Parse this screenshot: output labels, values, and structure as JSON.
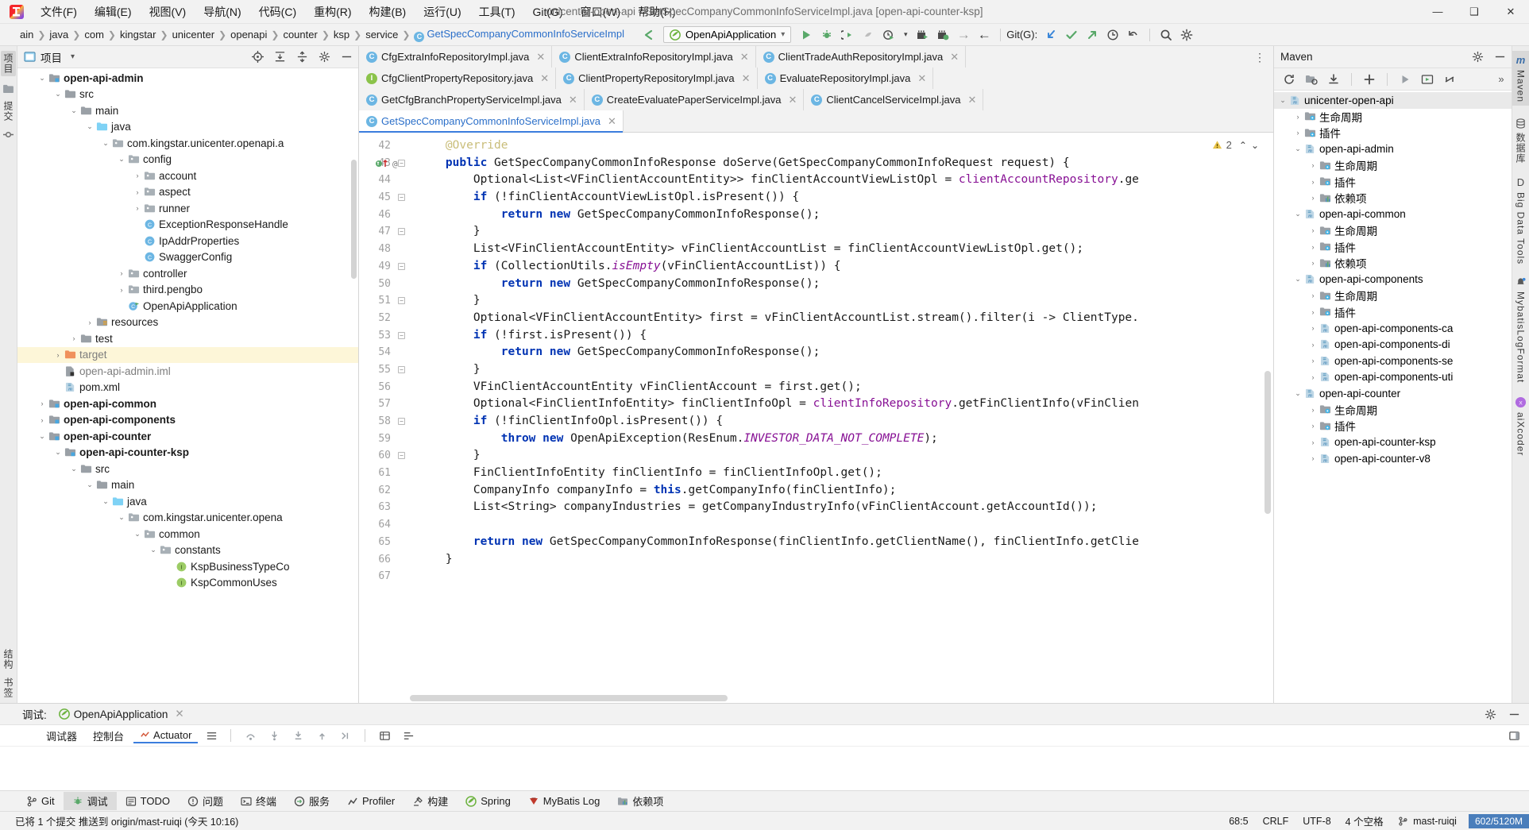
{
  "window": {
    "title": "unicenter-open-api - GetSpecCompanyCommonInfoServiceImpl.java [open-api-counter-ksp]",
    "minimize": "—",
    "maximize": "❑",
    "close": "✕"
  },
  "menu": [
    {
      "label": "文件(F)"
    },
    {
      "label": "编辑(E)"
    },
    {
      "label": "视图(V)"
    },
    {
      "label": "导航(N)"
    },
    {
      "label": "代码(C)"
    },
    {
      "label": "重构(R)"
    },
    {
      "label": "构建(B)"
    },
    {
      "label": "运行(U)"
    },
    {
      "label": "工具(T)"
    },
    {
      "label": "Git(G)"
    },
    {
      "label": "窗口(W)"
    },
    {
      "label": "帮助(H)"
    }
  ],
  "navbar": {
    "crumbs": [
      "ain",
      "java",
      "com",
      "kingstar",
      "unicenter",
      "openapi",
      "counter",
      "ksp",
      "service"
    ],
    "current_file": "GetSpecCompanyCommonInfoServiceImpl",
    "run_config": "OpenApiApplication",
    "git_label": "Git(G):"
  },
  "project_panel": {
    "title": "项目",
    "tree": [
      {
        "indent": 1,
        "twisty": "down",
        "icon": "module",
        "label": "open-api-admin",
        "bold": true
      },
      {
        "indent": 2,
        "twisty": "down",
        "icon": "folder",
        "label": "src"
      },
      {
        "indent": 3,
        "twisty": "down",
        "icon": "folder",
        "label": "main"
      },
      {
        "indent": 4,
        "twisty": "down",
        "icon": "srcfolder",
        "label": "java"
      },
      {
        "indent": 5,
        "twisty": "down",
        "icon": "package",
        "label": "com.kingstar.unicenter.openapi.a"
      },
      {
        "indent": 6,
        "twisty": "down",
        "icon": "package",
        "label": "config"
      },
      {
        "indent": 7,
        "twisty": "right",
        "icon": "package",
        "label": "account"
      },
      {
        "indent": 7,
        "twisty": "right",
        "icon": "package",
        "label": "aspect"
      },
      {
        "indent": 7,
        "twisty": "right",
        "icon": "package",
        "label": "runner"
      },
      {
        "indent": 7,
        "twisty": "none",
        "icon": "class",
        "label": "ExceptionResponseHandle"
      },
      {
        "indent": 7,
        "twisty": "none",
        "icon": "class",
        "label": "IpAddrProperties"
      },
      {
        "indent": 7,
        "twisty": "none",
        "icon": "class",
        "label": "SwaggerConfig"
      },
      {
        "indent": 6,
        "twisty": "right",
        "icon": "package",
        "label": "controller"
      },
      {
        "indent": 6,
        "twisty": "right",
        "icon": "package",
        "label": "third.pengbo"
      },
      {
        "indent": 6,
        "twisty": "none",
        "icon": "springclass",
        "label": "OpenApiApplication"
      },
      {
        "indent": 4,
        "twisty": "right",
        "icon": "resfolder",
        "label": "resources"
      },
      {
        "indent": 3,
        "twisty": "right",
        "icon": "folder",
        "label": "test"
      },
      {
        "indent": 2,
        "twisty": "right",
        "icon": "target",
        "label": "target",
        "highlight": true,
        "muted": true
      },
      {
        "indent": 2,
        "twisty": "none",
        "icon": "iml",
        "label": "open-api-admin.iml",
        "muted": true
      },
      {
        "indent": 2,
        "twisty": "none",
        "icon": "maven",
        "label": "pom.xml"
      },
      {
        "indent": 1,
        "twisty": "right",
        "icon": "module",
        "label": "open-api-common",
        "bold": true
      },
      {
        "indent": 1,
        "twisty": "right",
        "icon": "module",
        "label": "open-api-components",
        "bold": true
      },
      {
        "indent": 1,
        "twisty": "down",
        "icon": "module",
        "label": "open-api-counter",
        "bold": true
      },
      {
        "indent": 2,
        "twisty": "down",
        "icon": "module",
        "label": "open-api-counter-ksp",
        "bold": true
      },
      {
        "indent": 3,
        "twisty": "down",
        "icon": "folder",
        "label": "src"
      },
      {
        "indent": 4,
        "twisty": "down",
        "icon": "folder",
        "label": "main"
      },
      {
        "indent": 5,
        "twisty": "down",
        "icon": "srcfolder",
        "label": "java"
      },
      {
        "indent": 6,
        "twisty": "down",
        "icon": "package",
        "label": "com.kingstar.unicenter.opena"
      },
      {
        "indent": 7,
        "twisty": "down",
        "icon": "package",
        "label": "common"
      },
      {
        "indent": 8,
        "twisty": "down",
        "icon": "package",
        "label": "constants"
      },
      {
        "indent": 9,
        "twisty": "none",
        "icon": "interface",
        "label": "KspBusinessTypeCo"
      },
      {
        "indent": 9,
        "twisty": "none",
        "icon": "interface",
        "label": "KspCommonUses"
      }
    ]
  },
  "editor": {
    "tab_rows": [
      [
        {
          "label": "CfgExtraInfoRepositoryImpl.java",
          "icon": "class"
        },
        {
          "label": "ClientExtraInfoRepositoryImpl.java",
          "icon": "class"
        },
        {
          "label": "ClientTradeAuthRepositoryImpl.java",
          "icon": "class"
        }
      ],
      [
        {
          "label": "CfgClientPropertyRepository.java",
          "icon": "interface"
        },
        {
          "label": "ClientPropertyRepositoryImpl.java",
          "icon": "class"
        },
        {
          "label": "EvaluateRepositoryImpl.java",
          "icon": "class"
        }
      ],
      [
        {
          "label": "GetCfgBranchPropertyServiceImpl.java",
          "icon": "class"
        },
        {
          "label": "CreateEvaluatePaperServiceImpl.java",
          "icon": "class"
        },
        {
          "label": "ClientCancelServiceImpl.java",
          "icon": "class"
        }
      ],
      [
        {
          "label": "GetSpecCompanyCommonInfoServiceImpl.java",
          "icon": "class",
          "active": true
        }
      ]
    ],
    "warning_count": "2",
    "lines": [
      {
        "n": "42",
        "html": "    <span class=\"ann\">@Override</span>",
        "partial": true
      },
      {
        "n": "43",
        "html": "    <span class=\"kw\">public</span> GetSpecCompanyCommonInfoResponse doServe(GetSpecCompanyCommonInfoRequest request) {",
        "gutter_marks": true,
        "fold": true
      },
      {
        "n": "44",
        "html": "        Optional&lt;List&lt;VFinClientAccountEntity&gt;&gt; finClientAccountViewListOpl = <span class=\"fld\">clientAccountRepository</span>.ge"
      },
      {
        "n": "45",
        "html": "        <span class=\"kw\">if</span> (!finClientAccountViewListOpl.isPresent()) {",
        "fold": true
      },
      {
        "n": "46",
        "html": "            <span class=\"kw\">return</span> <span class=\"kw\">new</span> GetSpecCompanyCommonInfoResponse();"
      },
      {
        "n": "47",
        "html": "        }",
        "fold": true
      },
      {
        "n": "48",
        "html": "        List&lt;VFinClientAccountEntity&gt; vFinClientAccountList = finClientAccountViewListOpl.get();"
      },
      {
        "n": "49",
        "html": "        <span class=\"kw\">if</span> (CollectionUtils.<span class=\"stat\">isEmpty</span>(vFinClientAccountList)) {",
        "fold": true
      },
      {
        "n": "50",
        "html": "            <span class=\"kw\">return</span> <span class=\"kw\">new</span> GetSpecCompanyCommonInfoResponse();"
      },
      {
        "n": "51",
        "html": "        }",
        "fold": true
      },
      {
        "n": "52",
        "html": "        Optional&lt;VFinClientAccountEntity&gt; first = vFinClientAccountList.stream().filter(i -&gt; ClientType."
      },
      {
        "n": "53",
        "html": "        <span class=\"kw\">if</span> (!first.isPresent()) {",
        "fold": true
      },
      {
        "n": "54",
        "html": "            <span class=\"kw\">return</span> <span class=\"kw\">new</span> GetSpecCompanyCommonInfoResponse();"
      },
      {
        "n": "55",
        "html": "        }",
        "fold": true
      },
      {
        "n": "56",
        "html": "        VFinClientAccountEntity vFinClientAccount = first.get();"
      },
      {
        "n": "57",
        "html": "        Optional&lt;FinClientInfoEntity&gt; finClientInfoOpl = <span class=\"fld\">clientInfoRepository</span>.getFinClientInfo(vFinClien"
      },
      {
        "n": "58",
        "html": "        <span class=\"kw\">if</span> (!finClientInfoOpl.isPresent()) {",
        "fold": true
      },
      {
        "n": "59",
        "html": "            <span class=\"kw\">throw</span> <span class=\"kw\">new</span> OpenApiException(ResEnum.<span class=\"stat\">INVESTOR_DATA_NOT_COMPLETE</span>);"
      },
      {
        "n": "60",
        "html": "        }",
        "fold": true
      },
      {
        "n": "61",
        "html": "        FinClientInfoEntity finClientInfo = finClientInfoOpl.get();"
      },
      {
        "n": "62",
        "html": "        CompanyInfo companyInfo = <span class=\"kw\">this</span>.getCompanyInfo(finClientInfo);"
      },
      {
        "n": "63",
        "html": "        List&lt;String&gt; companyIndustries = getCompanyIndustryInfo(vFinClientAccount.getAccountId());"
      },
      {
        "n": "64",
        "html": ""
      },
      {
        "n": "65",
        "html": "        <span class=\"kw\">return</span> <span class=\"kw\">new</span> GetSpecCompanyCommonInfoResponse(finClientInfo.getClientName(), finClientInfo.getClie"
      },
      {
        "n": "66",
        "html": "    }"
      },
      {
        "n": "67",
        "html": ""
      }
    ]
  },
  "maven_panel": {
    "title": "Maven",
    "tree": [
      {
        "indent": 0,
        "twisty": "down",
        "icon": "maven",
        "label": "unicenter-open-api",
        "sel": true
      },
      {
        "indent": 1,
        "twisty": "right",
        "icon": "phase",
        "label": "生命周期"
      },
      {
        "indent": 1,
        "twisty": "right",
        "icon": "phase",
        "label": "插件"
      },
      {
        "indent": 1,
        "twisty": "down",
        "icon": "maven",
        "label": "open-api-admin"
      },
      {
        "indent": 2,
        "twisty": "right",
        "icon": "phase",
        "label": "生命周期"
      },
      {
        "indent": 2,
        "twisty": "right",
        "icon": "phase",
        "label": "插件"
      },
      {
        "indent": 2,
        "twisty": "right",
        "icon": "dep",
        "label": "依赖项"
      },
      {
        "indent": 1,
        "twisty": "down",
        "icon": "maven",
        "label": "open-api-common"
      },
      {
        "indent": 2,
        "twisty": "right",
        "icon": "phase",
        "label": "生命周期"
      },
      {
        "indent": 2,
        "twisty": "right",
        "icon": "phase",
        "label": "插件"
      },
      {
        "indent": 2,
        "twisty": "right",
        "icon": "dep",
        "label": "依赖项"
      },
      {
        "indent": 1,
        "twisty": "down",
        "icon": "maven",
        "label": "open-api-components"
      },
      {
        "indent": 2,
        "twisty": "right",
        "icon": "phase",
        "label": "生命周期"
      },
      {
        "indent": 2,
        "twisty": "right",
        "icon": "phase",
        "label": "插件"
      },
      {
        "indent": 2,
        "twisty": "right",
        "icon": "maven",
        "label": "open-api-components-ca"
      },
      {
        "indent": 2,
        "twisty": "right",
        "icon": "maven",
        "label": "open-api-components-di"
      },
      {
        "indent": 2,
        "twisty": "right",
        "icon": "maven",
        "label": "open-api-components-se"
      },
      {
        "indent": 2,
        "twisty": "right",
        "icon": "maven",
        "label": "open-api-components-uti"
      },
      {
        "indent": 1,
        "twisty": "down",
        "icon": "maven",
        "label": "open-api-counter"
      },
      {
        "indent": 2,
        "twisty": "right",
        "icon": "phase",
        "label": "生命周期"
      },
      {
        "indent": 2,
        "twisty": "right",
        "icon": "phase",
        "label": "插件"
      },
      {
        "indent": 2,
        "twisty": "right",
        "icon": "maven",
        "label": "open-api-counter-ksp"
      },
      {
        "indent": 2,
        "twisty": "right",
        "icon": "maven",
        "label": "open-api-counter-v8"
      }
    ]
  },
  "left_strip": {
    "top": [
      "项目",
      "提交"
    ],
    "bottom": [
      "结构",
      "书签"
    ]
  },
  "right_strip": [
    "Maven",
    "数据库",
    "Big Data Tools",
    "MybatisLogFormat",
    "aiXcoder"
  ],
  "debug_panel": {
    "title": "调试:",
    "session": "OpenApiApplication",
    "tabs": [
      "调试器",
      "控制台",
      "Actuator"
    ]
  },
  "tool_windows": [
    {
      "label": "Git",
      "icon": "git"
    },
    {
      "label": "调试",
      "icon": "bug",
      "active": true
    },
    {
      "label": "TODO",
      "icon": "todo"
    },
    {
      "label": "问题",
      "icon": "problems"
    },
    {
      "label": "终端",
      "icon": "terminal"
    },
    {
      "label": "服务",
      "icon": "services"
    },
    {
      "label": "Profiler",
      "icon": "profiler"
    },
    {
      "label": "构建",
      "icon": "build"
    },
    {
      "label": "Spring",
      "icon": "spring"
    },
    {
      "label": "MyBatis Log",
      "icon": "mybatis"
    },
    {
      "label": "依赖项",
      "icon": "dep"
    }
  ],
  "status_bar": {
    "message": "已将 1 个提交 推送到 origin/mast-ruiqi (今天 10:16)",
    "caret": "68:5",
    "line_sep": "CRLF",
    "encoding": "UTF-8",
    "indent": "4 个空格",
    "branch": "mast-ruiqi",
    "memory": "602/5120M"
  },
  "colors": {
    "accent": "#3b7ddd",
    "link": "#2b6fc9",
    "keyword": "#0033b3",
    "field": "#871094",
    "memory_bg": "#4a7ebb",
    "highlight_row": "#fdf6d8"
  }
}
